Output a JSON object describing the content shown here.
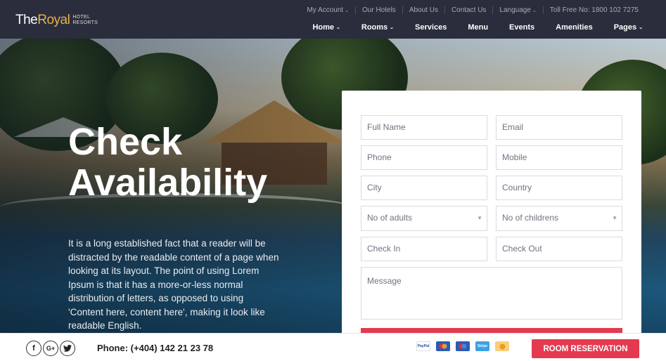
{
  "header": {
    "logo": {
      "main_a": "The",
      "main_b": "Royal",
      "sub_a": "HOTEL",
      "sub_b": "RESORTS"
    },
    "top_links": [
      {
        "label": "My Account",
        "dropdown": true
      },
      {
        "label": "Our Hotels",
        "dropdown": false
      },
      {
        "label": "About Us",
        "dropdown": false
      },
      {
        "label": "Contact Us",
        "dropdown": false
      },
      {
        "label": "Language",
        "dropdown": true
      },
      {
        "label": "Toll Free No: 1800 102 7275",
        "dropdown": false
      }
    ],
    "nav": [
      {
        "label": "Home",
        "dropdown": true
      },
      {
        "label": "Rooms",
        "dropdown": true
      },
      {
        "label": "Services",
        "dropdown": false
      },
      {
        "label": "Menu",
        "dropdown": false
      },
      {
        "label": "Events",
        "dropdown": false
      },
      {
        "label": "Amenities",
        "dropdown": false
      },
      {
        "label": "Pages",
        "dropdown": true
      }
    ],
    "caret": "⌄"
  },
  "hero": {
    "title_line1": "Check",
    "title_line2": "Availability",
    "text": "It is a long established fact that a reader will be distracted by the readable content of a page when looking at its layout. The point of using Lorem Ipsum is that it has a more-or-less normal distribution of letters, as opposed to using 'Content here, content here', making it look like readable English."
  },
  "form": {
    "full_name": "Full Name",
    "email": "Email",
    "phone": "Phone",
    "mobile": "Mobile",
    "city": "City",
    "country": "Country",
    "adults": "No of adults",
    "childrens": "No of childrens",
    "check_in": "Check In",
    "check_out": "Check Out",
    "message": "Message"
  },
  "footer": {
    "social": {
      "facebook": "f",
      "google_plus": "G+",
      "twitter": "t"
    },
    "phone": "Phone: (+404) 142 21 23 78",
    "payments": [
      {
        "name": "PayPal",
        "color": "#f2f4f8"
      },
      {
        "name": "MasterCard",
        "color": "#2a5bb5"
      },
      {
        "name": "Maestro",
        "color": "#2a5bb5"
      },
      {
        "name": "Stripe",
        "color": "#3ba1e6"
      },
      {
        "name": "Bitcoin",
        "color": "#f6d07a"
      }
    ],
    "reserve_label": "ROOM RESERVATION"
  },
  "colors": {
    "accent": "#e53950",
    "header_bg": "#2a2d3b",
    "logo_accent": "#e8b04a"
  }
}
